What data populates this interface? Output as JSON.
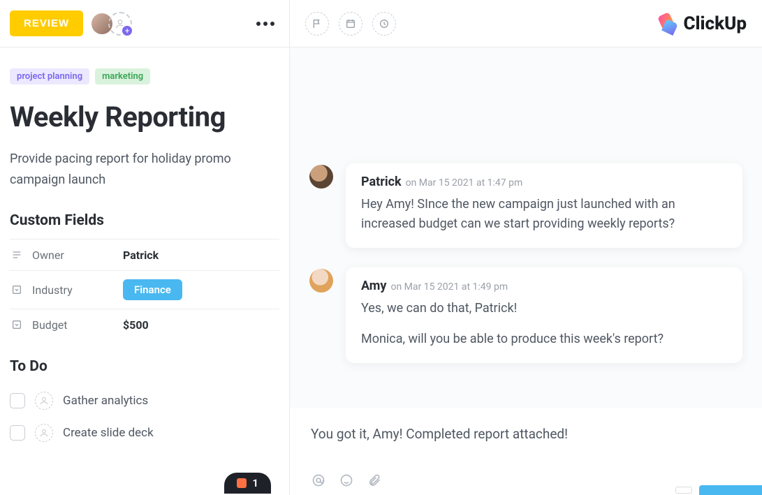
{
  "header": {
    "status_label": "REVIEW",
    "brand": "ClickUp"
  },
  "tags": [
    {
      "text": "project planning",
      "cls": "purple"
    },
    {
      "text": "marketing",
      "cls": "green"
    }
  ],
  "task": {
    "title": "Weekly Reporting",
    "description": "Provide pacing report for holiday promo campaign launch"
  },
  "custom_fields": {
    "heading": "Custom Fields",
    "rows": [
      {
        "label": "Owner",
        "value": "Patrick",
        "kind": "text"
      },
      {
        "label": "Industry",
        "value": "Finance",
        "kind": "badge"
      },
      {
        "label": "Budget",
        "value": "$500",
        "kind": "text"
      }
    ]
  },
  "todo": {
    "heading": "To Do",
    "items": [
      {
        "text": "Gather analytics"
      },
      {
        "text": "Create slide deck"
      }
    ]
  },
  "attachment_count": "1",
  "comments": [
    {
      "author": "Patrick",
      "avatar": "patrick",
      "timestamp": "on Mar 15 2021 at 1:47 pm",
      "paragraphs": [
        "Hey Amy! SInce the new campaign just launched with an increased budget can we start providing weekly reports?"
      ]
    },
    {
      "author": "Amy",
      "avatar": "amy",
      "timestamp": "on Mar 15 2021 at 1:49 pm",
      "paragraphs": [
        "Yes, we can do that, Patrick!",
        "Monica, will you be able to produce this week's report?"
      ]
    }
  ],
  "composer": {
    "draft": "You got it, Amy! Completed report attached!"
  }
}
